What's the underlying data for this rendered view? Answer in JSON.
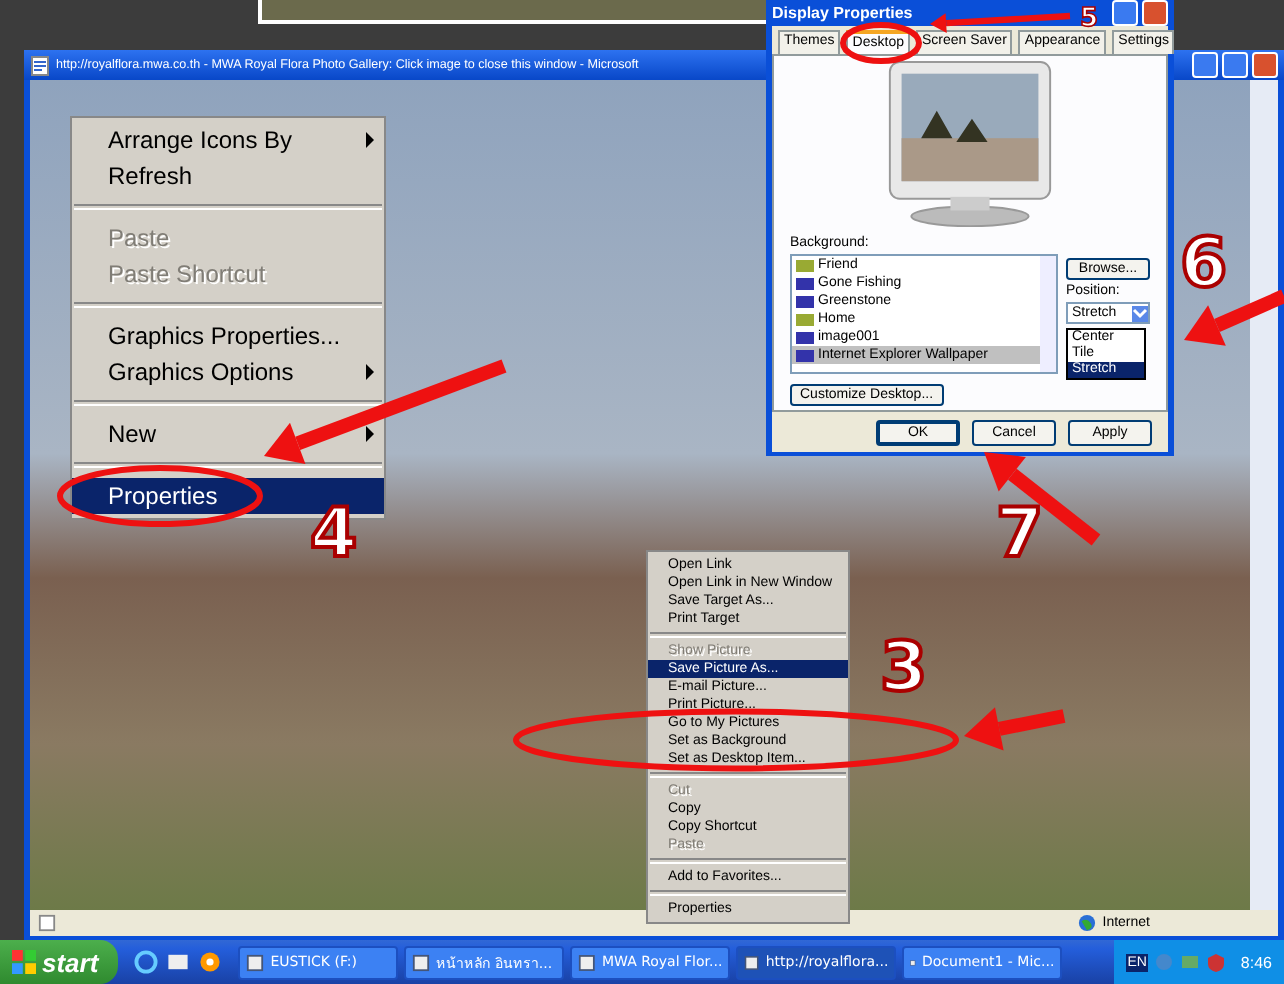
{
  "browser_window": {
    "title": "http://royalflora.mwa.co.th - MWA Royal Flora Photo Gallery: Click image to close this window - Microsoft",
    "status_bar": {
      "zone": "Internet"
    }
  },
  "desktop_menu": [
    {
      "label": "Arrange Icons By",
      "kind": "submenu",
      "selected": false
    },
    {
      "label": "Refresh",
      "kind": "item",
      "selected": false
    },
    {
      "kind": "separator"
    },
    {
      "label": "Paste",
      "kind": "disabled",
      "selected": false
    },
    {
      "label": "Paste Shortcut",
      "kind": "disabled",
      "selected": false
    },
    {
      "kind": "separator"
    },
    {
      "label": "Graphics Properties...",
      "kind": "item",
      "selected": false
    },
    {
      "label": "Graphics Options",
      "kind": "submenu",
      "selected": false
    },
    {
      "kind": "separator"
    },
    {
      "label": "New",
      "kind": "submenu",
      "selected": false
    },
    {
      "kind": "separator"
    },
    {
      "label": "Properties",
      "kind": "item",
      "selected": true
    }
  ],
  "picture_menu": [
    {
      "label": "Open Link",
      "kind": "item",
      "selected": false
    },
    {
      "label": "Open Link in New Window",
      "kind": "item",
      "selected": false
    },
    {
      "label": "Save Target As...",
      "kind": "item",
      "selected": false
    },
    {
      "label": "Print Target",
      "kind": "item",
      "selected": false
    },
    {
      "kind": "separator"
    },
    {
      "label": "Show Picture",
      "kind": "disabled",
      "selected": false
    },
    {
      "label": "Save Picture As...",
      "kind": "item",
      "selected": true
    },
    {
      "label": "E-mail Picture...",
      "kind": "item",
      "selected": false
    },
    {
      "label": "Print Picture...",
      "kind": "item",
      "selected": false
    },
    {
      "label": "Go to My Pictures",
      "kind": "item",
      "selected": false
    },
    {
      "label": "Set as Background",
      "kind": "item",
      "selected": false
    },
    {
      "label": "Set as Desktop Item...",
      "kind": "item",
      "selected": false
    },
    {
      "kind": "separator"
    },
    {
      "label": "Cut",
      "kind": "disabled",
      "selected": false
    },
    {
      "label": "Copy",
      "kind": "item",
      "selected": false
    },
    {
      "label": "Copy Shortcut",
      "kind": "item",
      "selected": false
    },
    {
      "label": "Paste",
      "kind": "disabled",
      "selected": false
    },
    {
      "kind": "separator"
    },
    {
      "label": "Add to Favorites...",
      "kind": "item",
      "selected": false
    },
    {
      "kind": "separator"
    },
    {
      "label": "Properties",
      "kind": "item",
      "selected": false
    }
  ],
  "display_properties": {
    "title": "Display Properties",
    "tabs": [
      {
        "label": "Themes",
        "selected": false
      },
      {
        "label": "Desktop",
        "selected": true
      },
      {
        "label": "Screen Saver",
        "selected": false
      },
      {
        "label": "Appearance",
        "selected": false
      },
      {
        "label": "Settings",
        "selected": false
      }
    ],
    "background_label": "Background:",
    "backgrounds": [
      {
        "name": "Friend",
        "selected": false
      },
      {
        "name": "Gone Fishing",
        "selected": false
      },
      {
        "name": "Greenstone",
        "selected": false
      },
      {
        "name": "Home",
        "selected": false
      },
      {
        "name": "image001",
        "selected": false
      },
      {
        "name": "Internet Explorer Wallpaper",
        "selected": true
      }
    ],
    "browse_button": "Browse...",
    "position_label": "Position:",
    "position_value": "Stretch",
    "position_options": [
      {
        "label": "Center",
        "selected": false
      },
      {
        "label": "Tile",
        "selected": false
      },
      {
        "label": "Stretch",
        "selected": true
      }
    ],
    "customize_button": "Customize Desktop...",
    "buttons": [
      "OK",
      "Cancel",
      "Apply"
    ]
  },
  "annotations": [
    {
      "number": "5"
    },
    {
      "number": "4"
    },
    {
      "number": "3"
    },
    {
      "number": "6"
    },
    {
      "number": "7"
    }
  ],
  "taskbar": {
    "start": "start",
    "tasks": [
      {
        "label": "EUSTICK (F:)",
        "selected": false
      },
      {
        "label": "หน้าหลัก อินทรา...",
        "selected": false
      },
      {
        "label": "MWA Royal Flor...",
        "selected": false
      },
      {
        "label": "http://royalflora...",
        "selected": true
      },
      {
        "label": "Document1 - Mic...",
        "selected": false
      }
    ],
    "language": "EN",
    "clock": "8:46"
  }
}
